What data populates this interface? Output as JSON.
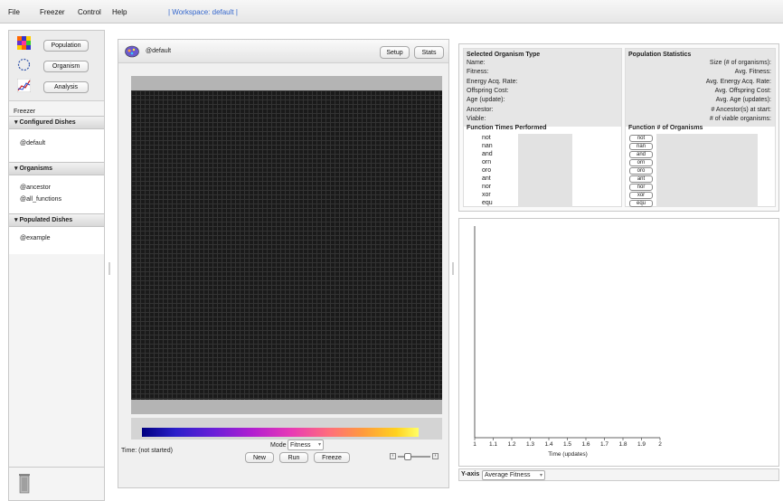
{
  "menubar": {
    "file": "File",
    "freezer": "Freezer",
    "control": "Control",
    "help": "Help",
    "workspace": "| Workspace: default |"
  },
  "nav": {
    "population": "Population",
    "organism": "Organism",
    "analysis": "Analysis"
  },
  "freezer": {
    "title": "Freezer",
    "configured_header": "▾ Configured Dishes",
    "configured_items": [
      "@default"
    ],
    "organisms_header": "▾ Organisms",
    "organism_items": [
      "@ancestor",
      "@all_functions"
    ],
    "populated_header": "▾ Populated Dishes",
    "populated_items": [
      "@example"
    ]
  },
  "center": {
    "dish_name": "@default",
    "setup_label": "Setup",
    "stats_label": "Stats",
    "time_text": "Time: (not started)",
    "mode_label": "Mode",
    "mode_value": "Fitness",
    "new_label": "New",
    "run_label": "Run",
    "freeze_label": "Freeze"
  },
  "org_type": {
    "title": "Selected Organism Type",
    "fields": [
      "Name:",
      "Fitness:",
      "Energy Acq. Rate:",
      "Offspring Cost:",
      "Age (update):",
      "Ancestor:",
      "Viable:"
    ],
    "func_header": "Function  Times Performed",
    "functions": [
      "not",
      "nan",
      "and",
      "orn",
      "oro",
      "ant",
      "nor",
      "xor",
      "equ"
    ]
  },
  "pop_stats": {
    "title": "Population Statistics",
    "fields": [
      "Size (# of organisms):",
      "Avg. Fitness:",
      "Avg. Energy Acq. Rate:",
      "Avg. Offspring Cost:",
      "Avg. Age (updates):",
      "# Ancestor(s) at start:",
      "# of viable organisms:"
    ],
    "func_header": "Function  # of Organisms",
    "functions": [
      "not",
      "nan",
      "and",
      "orn",
      "oro",
      "ant",
      "nor",
      "xor",
      "equ"
    ]
  },
  "graph": {
    "x_ticks": [
      "1",
      "1.1",
      "1.2",
      "1.3",
      "1.4",
      "1.5",
      "1.6",
      "1.7",
      "1.8",
      "1.9",
      "2"
    ],
    "x_label": "Time (updates)",
    "yaxis_label": "Y-axis",
    "yaxis_value": "Average Fitness"
  }
}
